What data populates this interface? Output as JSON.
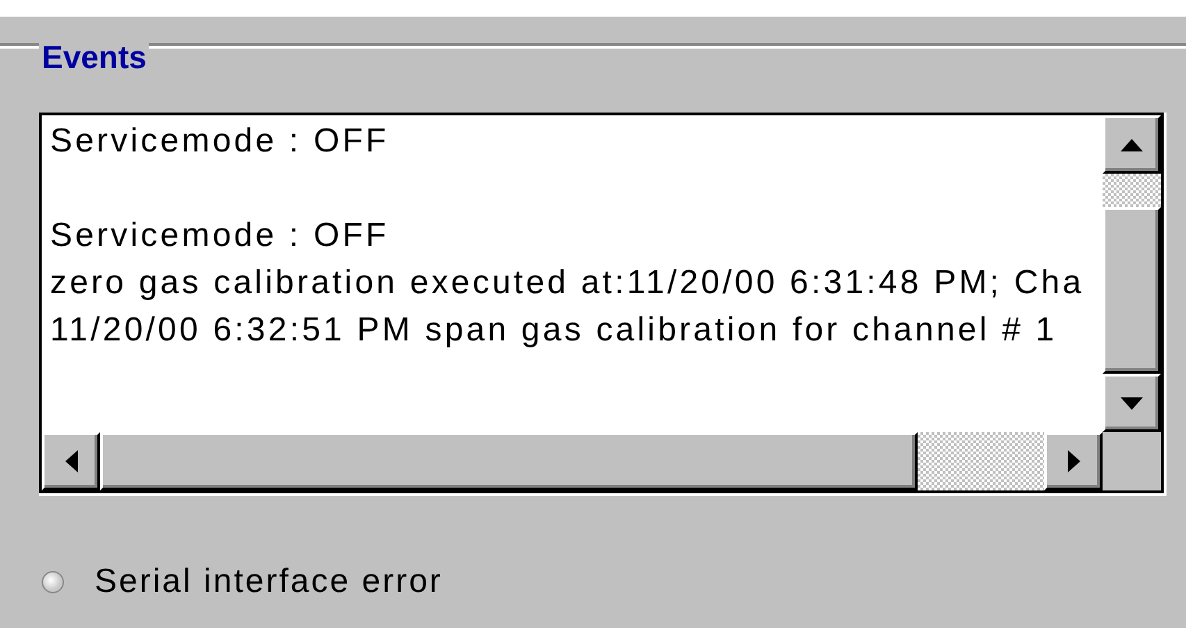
{
  "group": {
    "title": "Events"
  },
  "event_log": {
    "groups": [
      [
        "Servicemode : OFF"
      ],
      [
        "Servicemode : OFF",
        "zero gas calibration executed at:11/20/00 6:31:48 PM; Cha",
        "11/20/00 6:32:51 PM span gas calibration for channel # 1"
      ]
    ]
  },
  "indicators": [
    {
      "label": "Serial interface error",
      "on": false
    }
  ]
}
